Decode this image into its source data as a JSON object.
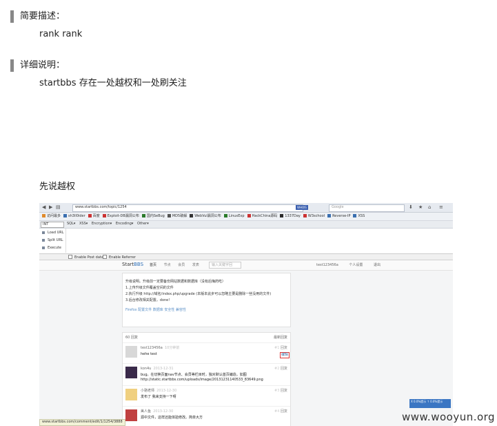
{
  "sections": [
    {
      "title": "简要描述：",
      "body": "rank rank"
    },
    {
      "title": "详细说明：",
      "body": "startbbs 存在一处越权和一处刷关注"
    }
  ],
  "intro_label": "先说越权",
  "screenshot": {
    "address_url": "www.startbbs.com/topic/1254",
    "whois_label": "WHOIS",
    "search_placeholder": "Google",
    "bookmarks": [
      {
        "label": "访问最多",
        "color": "#e08a2b"
      },
      {
        "label": "sh3ll0ider",
        "color": "#3a6fb0"
      },
      {
        "label": "百度",
        "color": "#cc3333"
      },
      {
        "label": "Exploit-DB漏洞公布",
        "color": "#cc3333"
      },
      {
        "label": "国内SeBug",
        "color": "#2a7a2a"
      },
      {
        "label": "MD5破解",
        "color": "#555555"
      },
      {
        "label": "WebVul漏洞公布",
        "color": "#333333"
      },
      {
        "label": "LinuxExp",
        "color": "#2a7a2a"
      },
      {
        "label": "HackChina源码",
        "color": "#cc3333"
      },
      {
        "label": "1337Day",
        "color": "#2a2a2a"
      },
      {
        "label": "W3school",
        "color": "#cc3333"
      },
      {
        "label": "Reverse-IP",
        "color": "#3a6fb0"
      },
      {
        "label": "XSS",
        "color": "#3a6fb0"
      }
    ],
    "hackbar_select": "INT",
    "hackbar_menu": [
      "SQL▾",
      "XSS▾",
      "Encryption▾",
      "Encoding▾",
      "Other▾"
    ],
    "hackbar_buttons": [
      "Load URL",
      "Split URL",
      "Execute"
    ],
    "options": [
      "Enable Post data",
      "Enable Referrer"
    ],
    "site": {
      "logo_prefix": "Start",
      "logo_suffix": "BBS",
      "nav": [
        "首页",
        "节点",
        "会员",
        "发表"
      ],
      "keyword_placeholder": "输入关键字回",
      "user_links": [
        "test123456a",
        "个人设置",
        "退出"
      ]
    },
    "post_lines": [
      "升级说明。升级前一定要备份网站数据和数据库（没有后悔药吃）",
      "1.上传升级文件覆盖空间的文件",
      "2.执行升级 http://域名/index.php/upgrade (本版本此步可以忽略主要是删除一些没用的文件)",
      "3.后台修改相关配置。done!"
    ],
    "post_tags": "Firefox  配置文件  数据库  安全性  兼容性",
    "comments_count": "60 回复",
    "comments_latest": "最新回复",
    "comments": [
      {
        "name": "test123456a",
        "time": "10分钟前",
        "body": "hehe test",
        "extra": "",
        "floor": "#1",
        "reply": "回复",
        "edit": "编辑"
      },
      {
        "name": "kon4u",
        "time": "2013-12-31",
        "body": "bug。在切换页面nav节点、会员等栏目时，独对默认首页编造。如图",
        "extra": "http://static.startbbs.com/uploads/image/20131231140533_83649.png",
        "floor": "#2",
        "reply": "回复",
        "edit": ""
      },
      {
        "name": "小骆老师",
        "time": "2013-12-30",
        "body": "发布了 我来支持一下呀",
        "extra": "",
        "floor": "#3",
        "reply": "回复",
        "edit": ""
      },
      {
        "name": "美人鱼",
        "time": "2013-12-30",
        "body": "源中文件，这样还能体验修改。简单大方",
        "extra": "",
        "floor": "#4",
        "reply": "回复",
        "edit": ""
      }
    ],
    "status_url": "www.startbbs.com/comment/edit/1/1254/3888",
    "popup_text": "X 0.0%提示 ↑  0.0%提示"
  },
  "watermark": "www.wooyun.org",
  "colors": {
    "accent": "#2d6fb7",
    "section_bar": "#888888",
    "highlight_box": "#dd3333"
  }
}
